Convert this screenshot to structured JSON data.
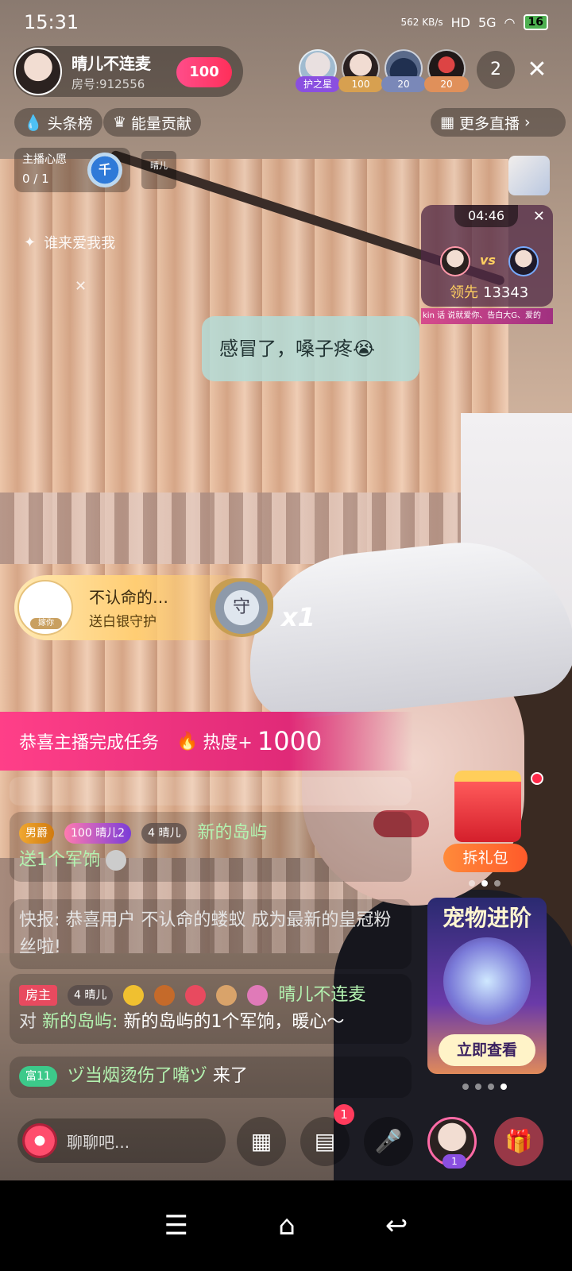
{
  "status_bar": {
    "time": "15:31",
    "net_speed": "562 KB/s",
    "hd": "HD",
    "signal": "5G",
    "battery": "16"
  },
  "anchor": {
    "name": "晴儿不连麦",
    "room": "房号:912556",
    "heart_level": "100"
  },
  "viewers": [
    {
      "tag": "护之星"
    },
    {
      "tag": "100"
    },
    {
      "tag": "20"
    },
    {
      "tag": "20"
    }
  ],
  "viewer_count": "2",
  "close_glyph": "✕",
  "ranks": {
    "headline": "头条榜",
    "energy": "能量贡献",
    "more_live": "更多直播"
  },
  "wish": {
    "label": "主播心愿",
    "progress": "0 / 1",
    "medal_char": "千",
    "badge_text": "晴儿"
  },
  "love_line": "谁来爱我我",
  "pk": {
    "timer": "04:46",
    "vs": "vs",
    "lead_label": "领先",
    "lead_value": "13343",
    "ticker": "kin 话   说就爱你、告白大G、爱的"
  },
  "speech_bubble": "感冒了，嗓子疼😭",
  "guard_banner": {
    "name": "不认命的…",
    "action": "送白银守护",
    "shield_char": "守",
    "avatar_label": "嫁你",
    "multiplier": "x1"
  },
  "task_ribbon": {
    "text": "恭喜主播完成任务",
    "heat_label": "热度+",
    "heat_value": "1000"
  },
  "chat": {
    "msg1": {
      "badge_duke": "男爵",
      "badge_heart_level": "100",
      "badge_heart_name": "晴儿2",
      "badge_lvl": "4",
      "badge_lvl_name": "晴儿",
      "user": "新的岛屿",
      "content": "送1个军饷"
    },
    "msg2": {
      "content": "快报: 恭喜用户 不认命的蝼蚁 成为最新的皇冠粉丝啦!"
    },
    "msg3": {
      "host_badge": "房主",
      "badge_lvl": "4",
      "badge_lvl_name": "晴儿",
      "user": "晴儿不连麦",
      "prefix": "对",
      "target": "新的岛屿:",
      "content": "新的岛屿的1个军饷，暖心～"
    },
    "msg4": {
      "badge_rich": "富11",
      "user": "ヅ当烟烫伤了嘴ヅ",
      "content": "来了"
    }
  },
  "gift_bag": {
    "button": "拆礼包"
  },
  "pet_card": {
    "title": "宠物进阶",
    "button": "立即查看"
  },
  "bottom_bar": {
    "placeholder": "聊聊吧...",
    "message_badge": "1",
    "anchor_level": "1"
  },
  "nav": {
    "menu": "☰",
    "home": "⌂",
    "back": "↩"
  },
  "colors": {
    "accent_pink": "#ff3f88",
    "gold": "#ffcf60",
    "chat_green": "#b3f2b0"
  }
}
